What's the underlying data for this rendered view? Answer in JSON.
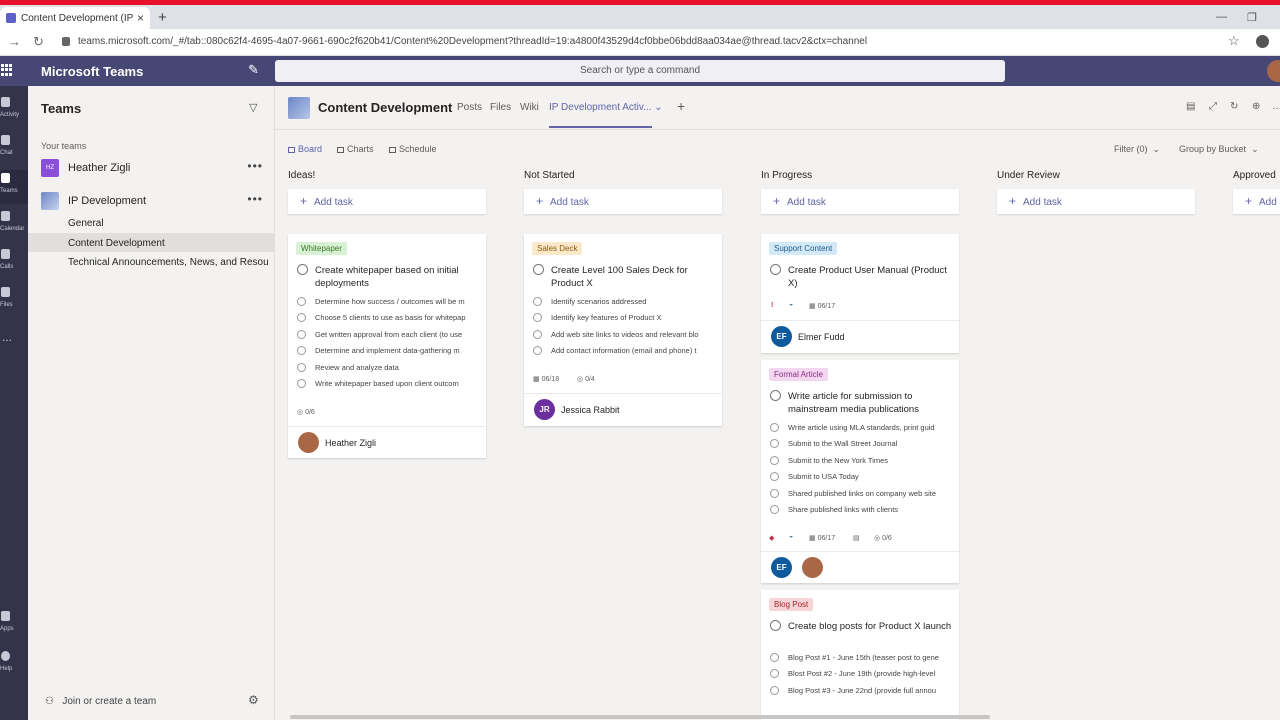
{
  "browser": {
    "tab_title": "Content Development (IP Develo",
    "url": "teams.microsoft.com/_#/tab::080c62f4-4695-4a07-9661-690c2f620b41/Content%20Development?threadId=19:a4800f43529d4cf0bbe06bdd8aa034ae@thread.tacv2&ctx=channel"
  },
  "teams": {
    "app_name": "Microsoft Teams",
    "search_placeholder": "Search or type a command"
  },
  "rail": [
    {
      "label": "Activity"
    },
    {
      "label": "Chat"
    },
    {
      "label": "Teams"
    },
    {
      "label": "Calendar"
    },
    {
      "label": "Calls"
    },
    {
      "label": "Files"
    },
    {
      "label": "..."
    },
    {
      "label": "Apps"
    },
    {
      "label": "Help"
    }
  ],
  "sidebar": {
    "title": "Teams",
    "section": "Your teams",
    "teams": [
      {
        "initials": "HZ",
        "name": "Heather Zigli",
        "more": "•••"
      },
      {
        "initials": "",
        "name": "IP Development",
        "more": "•••"
      }
    ],
    "channels": [
      "General",
      "Content Development",
      "Technical Announcements, News, and Resou..."
    ],
    "join": "Join or create a team"
  },
  "channel": {
    "name": "Content Development",
    "tabs": [
      "Posts",
      "Files",
      "Wiki",
      "IP Development Activ..."
    ]
  },
  "views": {
    "board": "Board",
    "charts": "Charts",
    "schedule": "Schedule",
    "filter": "Filter (0)",
    "group_by": "Group by Bucket"
  },
  "buckets": [
    {
      "title": "Ideas!",
      "add": "Add task"
    },
    {
      "title": "Not Started",
      "add": "Add task"
    },
    {
      "title": "In Progress",
      "add": "Add task"
    },
    {
      "title": "Under Review",
      "add": "Add task"
    },
    {
      "title": "Approved",
      "add": "Add"
    }
  ],
  "cards": {
    "whitepaper": {
      "label": "Whitepaper",
      "title": "Create whitepaper based on initial deployments",
      "items": [
        "Determine how success / outcomes will be m",
        "Choose 5 clients to use as basis for whitepap",
        "Get written approval from each client (to use",
        "Determine and implement data-gathering m",
        "Review and analyze data",
        "Write whitepaper based upon client outcom"
      ],
      "progress": "0/6",
      "assignee": "Heather Zigli"
    },
    "salesdeck": {
      "label": "Sales Deck",
      "title": "Create Level 100 Sales Deck for Product X",
      "items": [
        "Identify scenarios addressed",
        "Identify key features of Product X",
        "Add web site links to videos and relevant blo",
        "Add contact information (email and phone) t"
      ],
      "date": "06/18",
      "progress": "0/4",
      "assignee_initials": "JR",
      "assignee": "Jessica Rabbit"
    },
    "support": {
      "label": "Support Content",
      "title": "Create Product User Manual (Product X)",
      "priority": "!",
      "date": "06/17",
      "assignee_initials": "EF",
      "assignee": "Elmer Fudd"
    },
    "formal": {
      "label": "Formal Article",
      "title": "Write article for submission to mainstream media publications",
      "items": [
        "Write article using MLA standards, print guid",
        "Submit to the Wall Street Journal",
        "Submit to the New York Times",
        "Submit to USA Today",
        "Shared published links on company web site",
        "Share published links with clients"
      ],
      "date": "06/17",
      "progress": "0/6",
      "assignee_initials": "EF"
    },
    "blog": {
      "label": "Blog Post",
      "title": "Create blog posts for Product X launch",
      "items": [
        "Blog Post #1 - June 15th (teaser post to gene",
        "Blost Post #2 - June 19th (provide high-level",
        "Blog Post #3 - June 22nd (provide full annou"
      ]
    }
  },
  "colors": {
    "accent": "#6264a7",
    "header": "#464775",
    "rail": "#33344a"
  }
}
